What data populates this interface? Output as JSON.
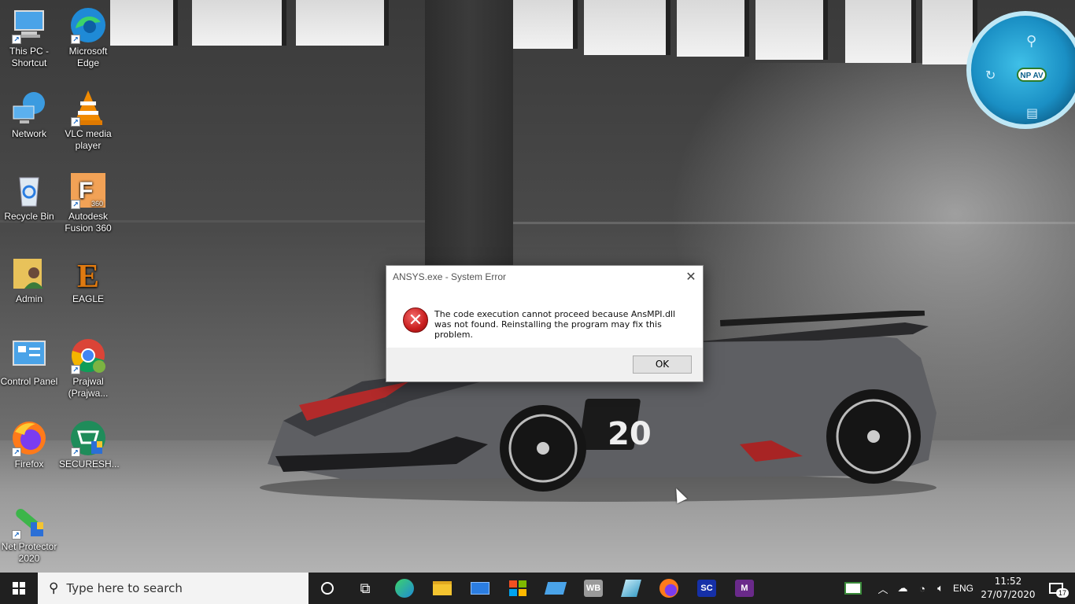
{
  "desktop": {
    "icons": [
      {
        "label": "This PC - Shortcut",
        "icon": "computer-icon"
      },
      {
        "label": "Microsoft Edge",
        "icon": "edge-icon"
      },
      {
        "label": "Network",
        "icon": "network-icon"
      },
      {
        "label": "VLC media player",
        "icon": "vlc-icon"
      },
      {
        "label": "Recycle Bin",
        "icon": "recycle-bin-icon"
      },
      {
        "label": "Autodesk Fusion 360",
        "icon": "fusion-360-icon"
      },
      {
        "label": "Admin",
        "icon": "user-folder-icon"
      },
      {
        "label": "EAGLE",
        "icon": "eagle-icon"
      },
      {
        "label": "Control Panel",
        "icon": "control-panel-icon"
      },
      {
        "label": "Prajwal (Prajwa...",
        "icon": "chrome-icon"
      },
      {
        "label": "Firefox",
        "icon": "firefox-icon"
      },
      {
        "label": "SECURESH...",
        "icon": "secure-shopping-icon"
      },
      {
        "label": "Net Protector 2020",
        "icon": "net-protector-icon"
      }
    ]
  },
  "gadget": {
    "label": "NP AV"
  },
  "wallpaper": {
    "car_number": "20"
  },
  "dialog": {
    "title": "ANSYS.exe - System Error",
    "message": "The code execution cannot proceed because AnsMPI.dll was not found. Reinstalling the program may fix this problem.",
    "ok_label": "OK",
    "close_glyph": "✕"
  },
  "taskbar": {
    "search_placeholder": "Type here to search",
    "apps": [
      {
        "name": "cortana",
        "icon": "cortana-icon"
      },
      {
        "name": "task-view",
        "icon": "task-view-icon"
      },
      {
        "name": "edge",
        "icon": "edge-icon"
      },
      {
        "name": "file-explorer",
        "icon": "folder-icon"
      },
      {
        "name": "mail",
        "icon": "mail-icon"
      },
      {
        "name": "store",
        "icon": "store-icon"
      },
      {
        "name": "pc-app",
        "icon": "computer-icon"
      },
      {
        "name": "workbench",
        "icon": "workbench-icon",
        "text": "WB"
      },
      {
        "name": "gadget-app",
        "icon": "gadget-icon"
      },
      {
        "name": "firefox",
        "icon": "firefox-icon"
      },
      {
        "name": "spaceclaim",
        "icon": "spaceclaim-icon",
        "text": "SC"
      },
      {
        "name": "mechanical",
        "icon": "mechanical-icon",
        "text": "M"
      }
    ],
    "tray": {
      "language": "ENG",
      "time": "11:52",
      "date": "27/07/2020",
      "notification_count": "17"
    }
  },
  "colors": {
    "taskbar": "#202020",
    "error_red": "#c81e1e",
    "dialog_footer": "#f0f0f0"
  }
}
